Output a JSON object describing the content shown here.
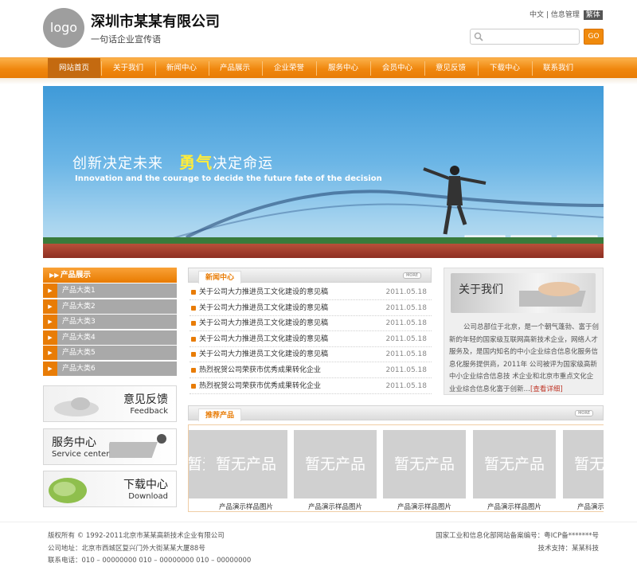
{
  "header": {
    "logo_text": "logo",
    "company_name": "深圳市某某有限公司",
    "slogan": "一句话企业宣传语",
    "top_links": [
      "中文",
      "信息管理"
    ],
    "traditional_label": "繁体",
    "search_placeholder": "",
    "go_label": "GO"
  },
  "nav": {
    "items": [
      "网站首页",
      "关于我们",
      "新闻中心",
      "产品展示",
      "企业荣誉",
      "服务中心",
      "会员中心",
      "意见反馈",
      "下载中心",
      "联系我们"
    ],
    "active_index": 0
  },
  "banner": {
    "line1_a": "创新决定未来",
    "line1_hl": "勇气",
    "line1_b": "决定命运",
    "line2": "Innovation and the courage to decide the future fate of the decision"
  },
  "categories": {
    "title": "产品展示",
    "items": [
      "产品大类1",
      "产品大类2",
      "产品大类3",
      "产品大类4",
      "产品大类5",
      "产品大类6"
    ]
  },
  "side_boxes": [
    {
      "cn": "意见反馈",
      "en": "Feedback"
    },
    {
      "cn": "服务中心",
      "en": "Service center"
    },
    {
      "cn": "下载中心",
      "en": "Download"
    }
  ],
  "news": {
    "title": "新闻中心",
    "more": "MORE",
    "items": [
      {
        "title": "关于公司大力推进员工文化建设的意见稿",
        "date": "2011.05.18"
      },
      {
        "title": "关于公司大力推进员工文化建设的意见稿",
        "date": "2011.05.18"
      },
      {
        "title": "关于公司大力推进员工文化建设的意见稿",
        "date": "2011.05.18"
      },
      {
        "title": "关于公司大力推进员工文化建设的意见稿",
        "date": "2011.05.18"
      },
      {
        "title": "关于公司大力推进员工文化建设的意见稿",
        "date": "2011.05.18"
      },
      {
        "title": "热烈祝贺公司荣获市优秀成果转化企业",
        "date": "2011.05.18"
      },
      {
        "title": "热烈祝贺公司荣获市优秀成果转化企业",
        "date": "2011.05.18"
      }
    ]
  },
  "about": {
    "title": "关于我们",
    "text": "公司总部位于北京，是一个朝气蓬勃、富于创新的年轻的国家级互联网高新技术企业，网络人才服务及，是国内知名的中小企业综合信息化服务信息化服务提供商，2011年 公司被评为国家级高新中小企业综合信息技 术企业和北京市重点文化企业业综合信息化富于创新…",
    "more": "[查看详细]"
  },
  "products": {
    "title": "推荐产品",
    "more": "MORE",
    "placeholder": "暂无产品",
    "items": [
      "产品演示样品图片",
      "产品演示样品图片",
      "产品演示样品图片",
      "产品演示样品图片",
      "产品演示样品图片"
    ]
  },
  "footer": {
    "copyright": "版权所有 © 1992-2011北京市某某高新技术企业有限公司",
    "address": "公司地址：北京市西城区复兴门外大街某某大厦88号",
    "phone": "联系电话：010 – 00000000 010 – 00000000 010 – 00000000",
    "icp": "国家工业和信息化部网站备案编号：粤ICP备*******号",
    "support": "技术支持：某某科技"
  },
  "colors": {
    "accent": "#e87c06",
    "category_bg": "#a9a9a9"
  }
}
